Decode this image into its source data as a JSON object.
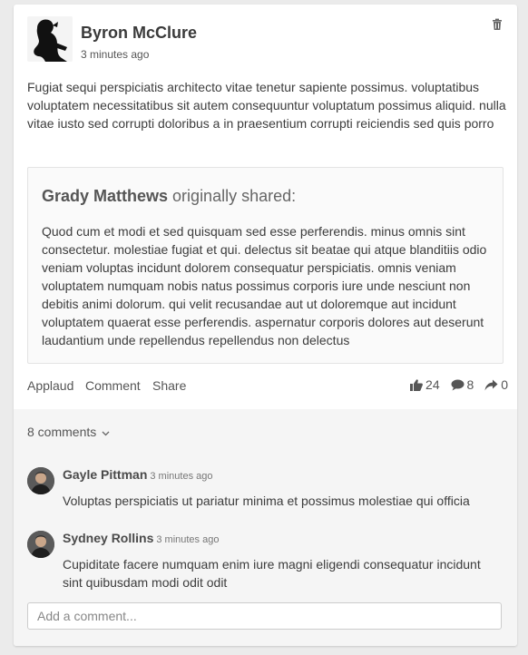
{
  "post": {
    "author": "Byron McClure",
    "time": "3 minutes ago",
    "body": "Fugiat sequi perspiciatis architecto vitae tenetur sapiente possimus. voluptatibus voluptatem necessitatibus sit autem consequuntur voluptatum possimus aliquid. nulla vitae iusto sed corrupti doloribus a in praesentium corrupti reiciendis sed quis porro",
    "delete_icon": "trash-icon"
  },
  "shared": {
    "author": "Grady Matthews",
    "suffix": " originally shared:",
    "body": "Quod cum et modi et sed quisquam sed esse perferendis. minus omnis sint consectetur. molestiae fugiat et qui. delectus sit beatae qui atque blanditiis odio veniam voluptas incidunt dolorem consequatur perspiciatis. omnis veniam voluptatem numquam nobis natus possimus corporis iure unde nesciunt non debitis animi dolorum. qui velit recusandae aut ut doloremque aut incidunt voluptatem quaerat esse perferendis. aspernatur corporis dolores aut deserunt laudantium unde repellendus repellendus non delectus"
  },
  "actions": {
    "applaud": "Applaud",
    "comment": "Comment",
    "share": "Share",
    "applause_count": "24",
    "comment_count": "8",
    "share_count": "0"
  },
  "comments": {
    "toggle_label": "8 comments",
    "items": [
      {
        "author": "Gayle Pittman",
        "time": "3 minutes ago",
        "text": "Voluptas perspiciatis ut pariatur minima et possimus molestiae qui officia"
      },
      {
        "author": "Sydney Rollins",
        "time": "3 minutes ago",
        "text": "Cupiditate facere numquam enim iure magni eligendi consequatur incidunt sint quibusdam modi odit odit"
      }
    ],
    "input_placeholder": "Add a comment..."
  }
}
